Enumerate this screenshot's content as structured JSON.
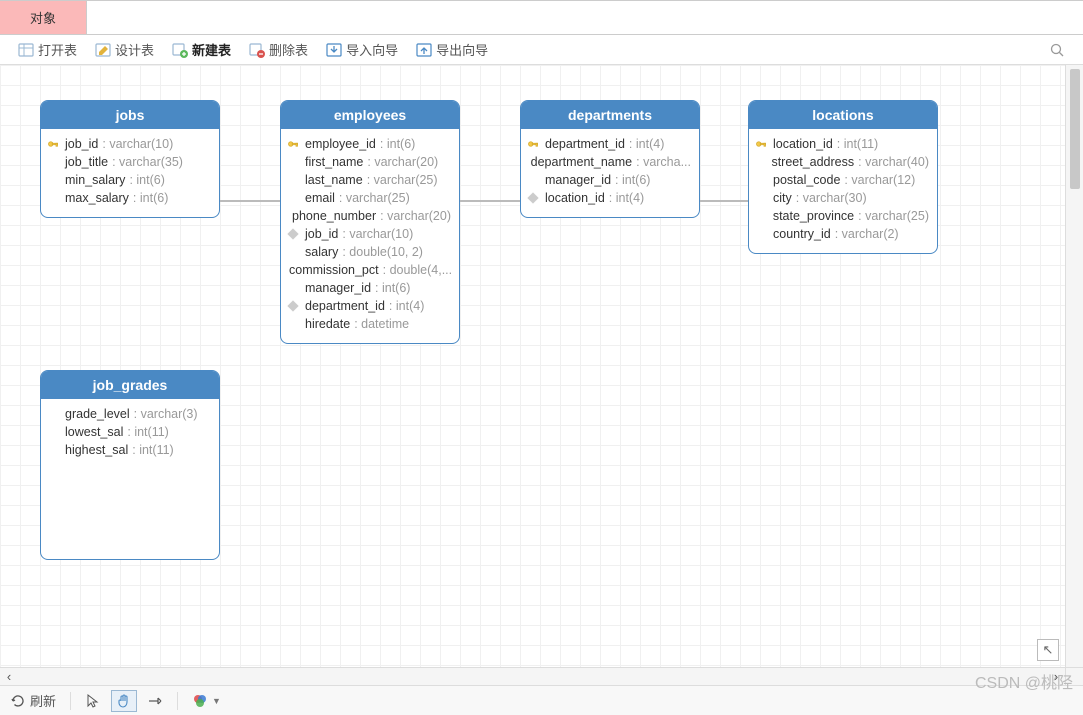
{
  "tab": {
    "label": "对象"
  },
  "toolbar": {
    "open": "打开表",
    "design": "设计表",
    "new": "新建表",
    "delete": "删除表",
    "import": "导入向导",
    "export": "导出向导"
  },
  "entities": {
    "jobs": {
      "title": "jobs",
      "fields": [
        {
          "icon": "key",
          "name": "job_id",
          "type": "varchar(10)"
        },
        {
          "icon": "",
          "name": "job_title",
          "type": "varchar(35)"
        },
        {
          "icon": "",
          "name": "min_salary",
          "type": "int(6)"
        },
        {
          "icon": "",
          "name": "max_salary",
          "type": "int(6)"
        }
      ]
    },
    "employees": {
      "title": "employees",
      "fields": [
        {
          "icon": "key",
          "name": "employee_id",
          "type": "int(6)"
        },
        {
          "icon": "",
          "name": "first_name",
          "type": "varchar(20)"
        },
        {
          "icon": "",
          "name": "last_name",
          "type": "varchar(25)"
        },
        {
          "icon": "",
          "name": "email",
          "type": "varchar(25)"
        },
        {
          "icon": "",
          "name": "phone_number",
          "type": "varchar(20)"
        },
        {
          "icon": "fk",
          "name": "job_id",
          "type": "varchar(10)"
        },
        {
          "icon": "",
          "name": "salary",
          "type": "double(10, 2)"
        },
        {
          "icon": "",
          "name": "commission_pct",
          "type": "double(4,..."
        },
        {
          "icon": "",
          "name": "manager_id",
          "type": "int(6)"
        },
        {
          "icon": "fk",
          "name": "department_id",
          "type": "int(4)"
        },
        {
          "icon": "",
          "name": "hiredate",
          "type": "datetime"
        }
      ]
    },
    "departments": {
      "title": "departments",
      "fields": [
        {
          "icon": "key",
          "name": "department_id",
          "type": "int(4)"
        },
        {
          "icon": "",
          "name": "department_name",
          "type": "varcha..."
        },
        {
          "icon": "",
          "name": "manager_id",
          "type": "int(6)"
        },
        {
          "icon": "fk",
          "name": "location_id",
          "type": "int(4)"
        }
      ]
    },
    "locations": {
      "title": "locations",
      "fields": [
        {
          "icon": "key",
          "name": "location_id",
          "type": "int(11)"
        },
        {
          "icon": "",
          "name": "street_address",
          "type": "varchar(40)"
        },
        {
          "icon": "",
          "name": "postal_code",
          "type": "varchar(12)"
        },
        {
          "icon": "",
          "name": "city",
          "type": "varchar(30)"
        },
        {
          "icon": "",
          "name": "state_province",
          "type": "varchar(25)"
        },
        {
          "icon": "",
          "name": "country_id",
          "type": "varchar(2)"
        }
      ]
    },
    "job_grades": {
      "title": "job_grades",
      "fields": [
        {
          "icon": "",
          "name": "grade_level",
          "type": "varchar(3)"
        },
        {
          "icon": "",
          "name": "lowest_sal",
          "type": "int(11)"
        },
        {
          "icon": "",
          "name": "highest_sal",
          "type": "int(11)"
        }
      ]
    }
  },
  "statusbar": {
    "refresh": "刷新"
  },
  "watermark": "CSDN @桃陉"
}
